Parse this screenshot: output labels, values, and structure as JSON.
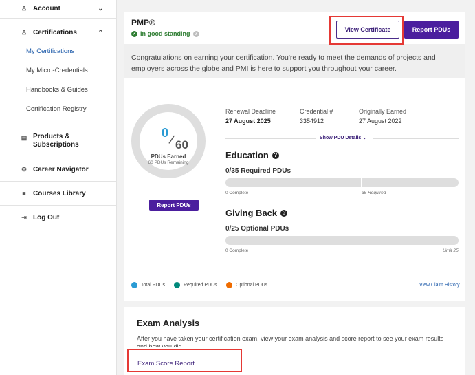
{
  "sidebar": {
    "account": "Account",
    "certifications": "Certifications",
    "sub_items": [
      "My Certifications",
      "My Micro-Credentials",
      "Handbooks & Guides",
      "Certification Registry"
    ],
    "products_line1": "Products &",
    "products_line2": "Subscriptions",
    "career": "Career Navigator",
    "courses": "Courses Library",
    "logout": "Log Out"
  },
  "certification": {
    "title": "PMP®",
    "standing": "In good standing",
    "view_certificate": "View Certificate",
    "report_pdus": "Report PDUs",
    "congrats": "Congratulations on earning your certification. You're ready to meet the demands of projects and employers across the globe and PMI is here to support you throughout your career.",
    "ring": {
      "earned_num": "0",
      "total": "60",
      "earned_label": "PDUs Earned",
      "remaining": "60 PDUs Remaining"
    },
    "report_pdus_small": "Report PDUs",
    "meta": {
      "renewal_label": "Renewal Deadline",
      "renewal_value": "27 August 2025",
      "credential_label": "Credential #",
      "credential_value": "3354912",
      "earned_label": "Originally Earned",
      "earned_value": "27 August 2022"
    },
    "show_pdu_details": "Show PDU Details ⌄",
    "education": {
      "title": "Education",
      "sub": "0/35 Required PDUs",
      "complete": "0 Complete",
      "required": "35 Required",
      "progress": 0
    },
    "giving_back": {
      "title": "Giving Back",
      "sub": "0/25 Optional PDUs",
      "complete": "0 Complete",
      "limit": "Limit 25",
      "progress": 0
    },
    "legend": [
      {
        "label": "Total PDUs",
        "color": "#2a9bd4"
      },
      {
        "label": "Required PDUs",
        "color": "#00897b"
      },
      {
        "label": "Optional PDUs",
        "color": "#ef6c00"
      }
    ],
    "view_claim_history": "View Claim History"
  },
  "exam": {
    "title": "Exam Analysis",
    "text_line1": "After you have taken your certification exam, view your exam analysis and score report to see your exam results",
    "text_line2": "and how you did.",
    "link": "Exam Score Report"
  }
}
